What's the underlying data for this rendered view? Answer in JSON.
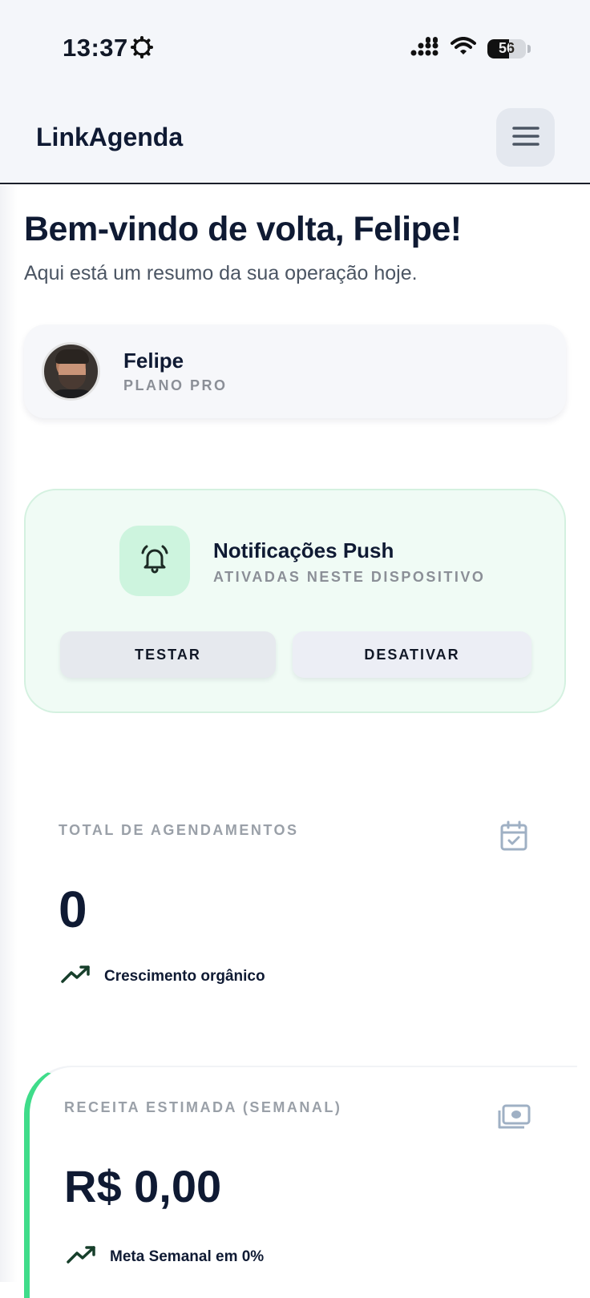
{
  "status": {
    "time": "13:37",
    "battery": "56"
  },
  "header": {
    "brand": "LinkAgenda"
  },
  "welcome": {
    "title": "Bem-vindo de volta, Felipe!",
    "subtitle": "Aqui está um resumo da sua operação hoje."
  },
  "profile": {
    "name": "Felipe",
    "plan": "PLANO PRO"
  },
  "push": {
    "title": "Notificações Push",
    "subtitle": "ATIVADAS NESTE DISPOSITIVO",
    "test_label": "TESTAR",
    "deactivate_label": "DESATIVAR"
  },
  "appointments": {
    "label": "TOTAL DE AGENDAMENTOS",
    "value": "0",
    "footnote": "Crescimento orgânico"
  },
  "revenue": {
    "label": "RECEITA ESTIMADA (SEMANAL)",
    "value": "R$ 0,00",
    "footnote": "Meta Semanal em 0%"
  },
  "colors": {
    "accent_green": "#3fdc8a",
    "push_bg": "#f0fbf5",
    "ink": "#0f1a33"
  },
  "icons": [
    "gear-icon",
    "signal-icon",
    "wifi-icon",
    "battery-icon",
    "menu-icon",
    "bell-icon",
    "calendar-check-icon",
    "trending-up-icon",
    "money-icon"
  ]
}
